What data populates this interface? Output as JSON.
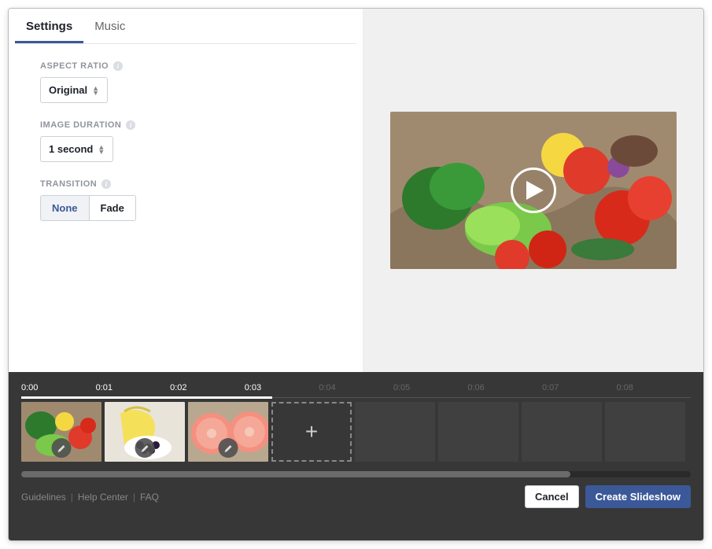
{
  "tabs": {
    "settings": "Settings",
    "music": "Music"
  },
  "aspect_ratio": {
    "label": "ASPECT RATIO",
    "value": "Original"
  },
  "image_duration": {
    "label": "IMAGE DURATION",
    "value": "1 second"
  },
  "transition": {
    "label": "TRANSITION",
    "options": [
      "None",
      "Fade"
    ],
    "selected": "None"
  },
  "timeline": {
    "marks": [
      "0:00",
      "0:01",
      "0:02",
      "0:03",
      "0:04",
      "0:05",
      "0:06",
      "0:07",
      "0:08"
    ],
    "active_until_index": 3,
    "slides": [
      {
        "type": "image",
        "name": "vegetables"
      },
      {
        "type": "image",
        "name": "bananas-berries"
      },
      {
        "type": "image",
        "name": "grapefruit"
      },
      {
        "type": "add"
      },
      {
        "type": "empty"
      },
      {
        "type": "empty"
      },
      {
        "type": "empty"
      },
      {
        "type": "empty"
      }
    ]
  },
  "footer": {
    "links": [
      "Guidelines",
      "Help Center",
      "FAQ"
    ],
    "cancel": "Cancel",
    "create": "Create Slideshow"
  },
  "add_icon": "+"
}
